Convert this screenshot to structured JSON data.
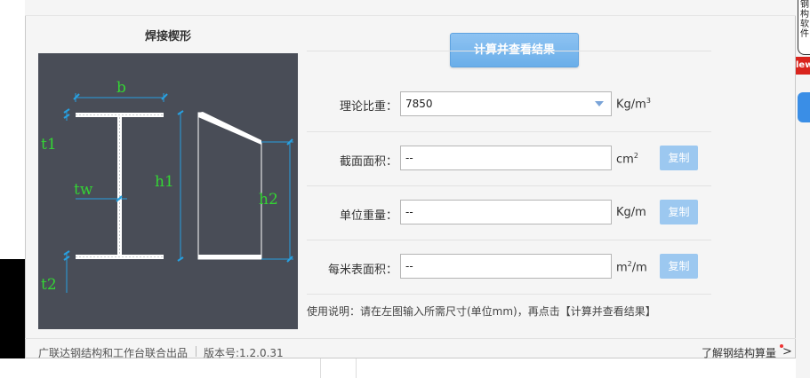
{
  "background": {
    "note_text": "钢\n构\n软\n件",
    "tag_text": "lew"
  },
  "left_panel": {
    "title": "焊接楔形",
    "labels": {
      "b": "b",
      "t1": "t1",
      "tw": "tw",
      "h1": "h1",
      "h2": "h2",
      "t2": "t2"
    }
  },
  "calc_button": "计算并查看结果",
  "rows": [
    {
      "label": "理论比重：",
      "value": "7850",
      "type": "dropdown",
      "unit": "Kg/m",
      "unit_sup": "3",
      "copy": ""
    },
    {
      "label": "截面面积：",
      "value": "--",
      "type": "text",
      "unit": "cm",
      "unit_sup": "2",
      "copy": "复制"
    },
    {
      "label": "单位重量：",
      "value": "--",
      "type": "text",
      "unit": "Kg/m",
      "unit_sup": "",
      "copy": "复制"
    },
    {
      "label": "每米表面积：",
      "value": "--",
      "type": "text",
      "unit_pre": "m",
      "unit_sup": "2",
      "unit_post": "/m",
      "copy": "复制"
    }
  ],
  "usage": "使用说明：请在左图输入所需尺寸(单位mm)，再点击【计算并查看结果】",
  "footer": {
    "left": "广联达钢结构和工作台联合出品",
    "version": "版本号:1.2.0.31",
    "right": "了解钢结构算量",
    "chevron": ">"
  },
  "colors": {
    "canvas": "#494d57",
    "dim_line": "#27a0e0",
    "label_green": "#34d434",
    "button": "#7ab8ee"
  }
}
